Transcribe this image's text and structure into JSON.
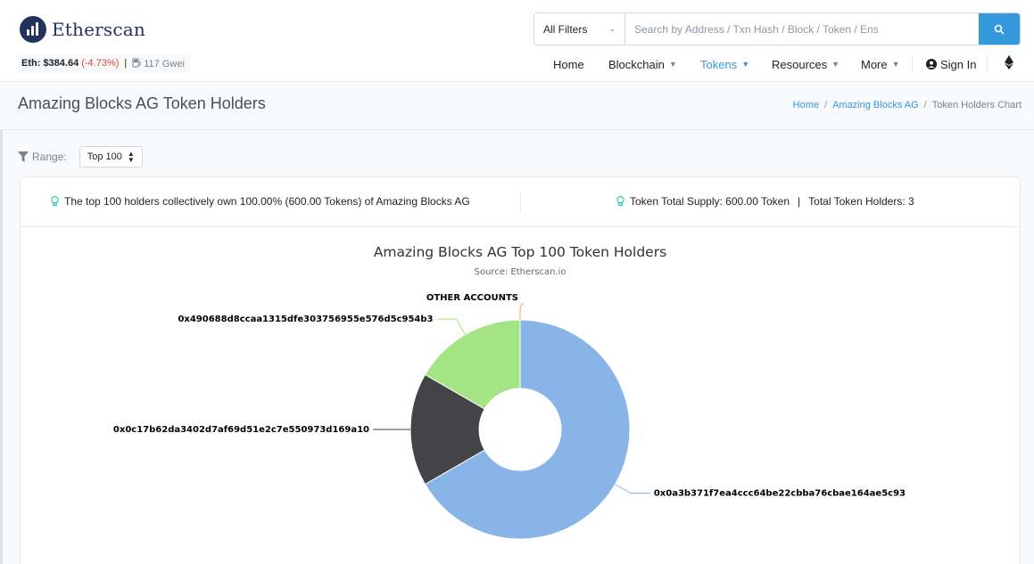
{
  "header": {
    "brand": "Etherscan",
    "price_label": "Eth: $384.64",
    "price_change": "(-4.73%)",
    "separator": "|",
    "gas": "117 Gwei",
    "search": {
      "filter_label": "All Filters",
      "placeholder": "Search by Address / Txn Hash / Block / Token / Ens"
    },
    "nav": {
      "home": "Home",
      "blockchain": "Blockchain",
      "tokens": "Tokens",
      "resources": "Resources",
      "more": "More",
      "sign_in": "Sign In"
    },
    "colors": {
      "brand": "#21325b",
      "accent": "#3498db",
      "negative": "#de4437"
    }
  },
  "page": {
    "title": "Amazing Blocks AG Token Holders",
    "breadcrumb": [
      "Home",
      "Amazing Blocks AG",
      "Token Holders Chart"
    ],
    "breadcrumb_sep": "/"
  },
  "range": {
    "label": "Range:",
    "selected": "Top 100"
  },
  "summary": {
    "holders_text": "The top 100 holders collectively own 100.00% (600.00 Tokens) of Amazing Blocks AG",
    "supply_text": "Token Total Supply: 600.00 Token",
    "sep": "|",
    "holders_count_text": "Total Token Holders: 3"
  },
  "chart_data": {
    "type": "pie",
    "style": "donut",
    "title": "Amazing Blocks AG Top 100 Token Holders",
    "subtitle": "Source: Etherscan.io",
    "slices": [
      {
        "label": "0x0a3b371f7ea4ccc64be22cbba76cbae164ae5c93",
        "value": 400,
        "color": "#88b4e7"
      },
      {
        "label": "0x0c17b62da3402d7af69d51e2c7e550973d169a10",
        "value": 100,
        "color": "#434348"
      },
      {
        "label": "0x490688d8ccaa1315dfe303756955e576d5c954b3",
        "value": 100,
        "color": "#a3e585"
      },
      {
        "label": "OTHER ACCOUNTS",
        "value": 0,
        "color": "#f7a35c"
      }
    ]
  }
}
